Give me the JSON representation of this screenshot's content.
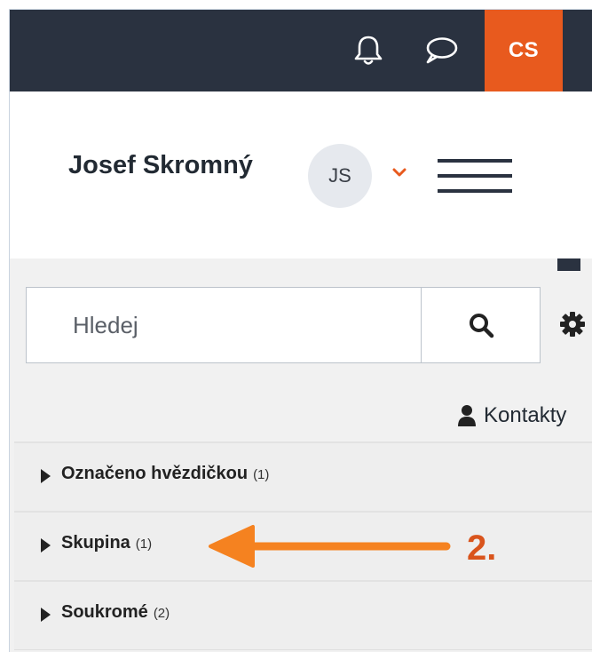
{
  "navbar": {
    "notifications_icon": "bell-icon",
    "messages_icon": "chat-bubble-icon",
    "language": "CS",
    "background_color": "#2a3240",
    "accent_color": "#e85a1e"
  },
  "user": {
    "name": "Josef Skromný",
    "initials": "JS",
    "menu_icon": "chevron-down-icon"
  },
  "search": {
    "placeholder": "Hledej",
    "button_icon": "search-icon",
    "settings_icon": "gear-icon"
  },
  "contacts": {
    "icon": "user-icon",
    "label": "Kontakty"
  },
  "groups": [
    {
      "label": "Označeno hvězdičkou",
      "count": "(1)"
    },
    {
      "label": "Skupina",
      "count": "(1)"
    },
    {
      "label": "Soukromé",
      "count": "(2)"
    }
  ],
  "annotation": {
    "label": "2.",
    "color": "#f58220"
  }
}
